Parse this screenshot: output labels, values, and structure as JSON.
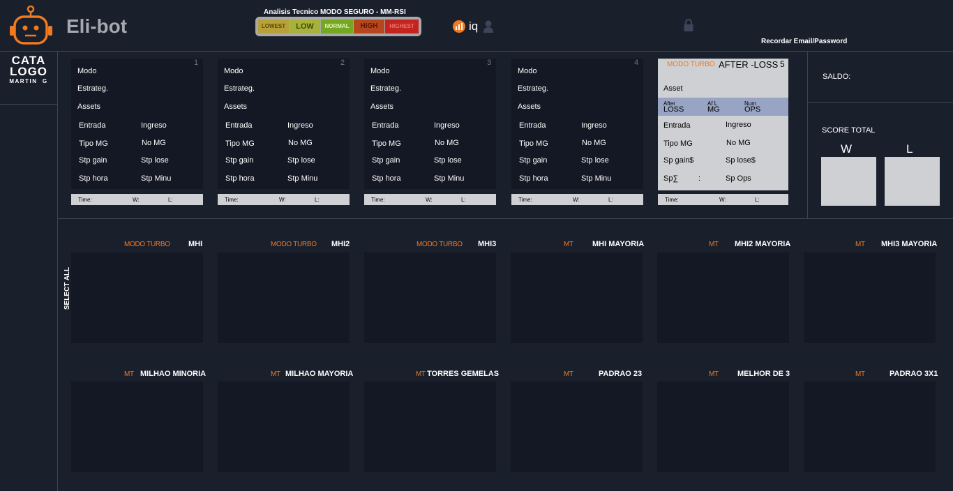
{
  "header": {
    "app_title": "Eli-bot",
    "analysis_title": "Analisis Tecnico MODO SEGURO - MM-RSI",
    "risk_levels": [
      {
        "label": "LOWEST",
        "bg": "#b8a138",
        "fg": "#5a4a08"
      },
      {
        "label": "LOW",
        "bg": "#a8b23a",
        "fg": "#3f4a0a"
      },
      {
        "label": "NORMAL",
        "bg": "#74a820",
        "fg": "#e3f0c0"
      },
      {
        "label": "HIGH",
        "bg": "#b5461d",
        "fg": "#5a1a05"
      },
      {
        "label": "HIGHEST",
        "bg": "#c4231f",
        "fg": "#e57a6a"
      }
    ],
    "broker_label": "iq",
    "remember_label": "Recordar Email/Password"
  },
  "logo": {
    "line1": "CATA",
    "line2": "LOGO",
    "line3": "MARTIN  G"
  },
  "config_panels": [
    {
      "number": "1",
      "modo": "Modo",
      "estrateg": "Estrateg.",
      "assets": "Assets",
      "entrada": "Entrada",
      "ingreso": "Ingreso",
      "tipo_mg": "Tipo MG",
      "no_mg": "No MG",
      "stp_gain": "Stp gain",
      "stp_lose": "Stp lose",
      "stp_hora": "Stp hora",
      "stp_minu": "Stp Minu",
      "time": "Time:",
      "w": "W:",
      "l": "L:"
    },
    {
      "number": "2",
      "modo": "Modo",
      "estrateg": "Estrateg.",
      "assets": "Assets",
      "entrada": "Entrada",
      "ingreso": "Ingreso",
      "tipo_mg": "Tipo MG",
      "no_mg": "No MG",
      "stp_gain": "Stp gain",
      "stp_lose": "Stp lose",
      "stp_hora": "Stp hora",
      "stp_minu": "Stp Minu",
      "time": "Time:",
      "w": "W:",
      "l": "L:"
    },
    {
      "number": "3",
      "modo": "Modo",
      "estrateg": "Estrateg.",
      "assets": "Assets",
      "entrada": "Entrada",
      "ingreso": "Ingreso",
      "tipo_mg": "Tipo MG",
      "no_mg": "No MG",
      "stp_gain": "Stp gain",
      "stp_lose": "Stp lose",
      "stp_hora": "Stp hora",
      "stp_minu": "Stp Minu",
      "time": "Time:",
      "w": "W:",
      "l": "L:"
    },
    {
      "number": "4",
      "modo": "Modo",
      "estrateg": "Estrateg.",
      "assets": "Assets",
      "entrada": "Entrada",
      "ingreso": "Ingreso",
      "tipo_mg": "Tipo MG",
      "no_mg": "No MG",
      "stp_gain": "Stp gain",
      "stp_lose": "Stp lose",
      "stp_hora": "Stp hora",
      "stp_minu": "Stp Minu",
      "time": "Time:",
      "w": "W:",
      "l": "L:"
    }
  ],
  "afterloss_panel": {
    "number": "5",
    "tag": "MODO TURBO",
    "title": "AFTER -LOSS",
    "asset": "Asset",
    "col1_small": "After",
    "col1_big": "LOSS",
    "col2_small": "Af L",
    "col2_big": "MG",
    "col3_small": "Num",
    "col3_big": "OPS",
    "entrada": "Entrada",
    "ingreso": "Ingreso",
    "tipo_mg": "Tipo MG",
    "no_mg": "No MG",
    "sp_gain": "Sp gain$",
    "sp_lose": "Sp lose$",
    "sp_sigma": "Sp∑",
    "sp_colon": ":",
    "sp_ops": "Sp Ops",
    "time": "Time:",
    "w": "W:",
    "l": "L:"
  },
  "score": {
    "saldo_label": "SALDO:",
    "total_label": "SCORE TOTAL",
    "w_label": "W",
    "l_label": "L"
  },
  "select_all_label": "SELECT ALL",
  "strategies_row1": [
    {
      "tag": "MODO TURBO",
      "name": "MHI"
    },
    {
      "tag": "MODO TURBO",
      "name": "MHI2"
    },
    {
      "tag": "MODO TURBO",
      "name": "MHI3"
    },
    {
      "tag": "MT",
      "name": "MHI MAYORIA"
    },
    {
      "tag": "MT",
      "name": "MHI2 MAYORIA"
    },
    {
      "tag": "MT",
      "name": "MHI3 MAYORIA"
    }
  ],
  "strategies_row2": [
    {
      "tag": "MT",
      "name": "MILHAO MINORIA"
    },
    {
      "tag": "MT",
      "name": "MILHAO MAYORIA"
    },
    {
      "tag": "MT",
      "name": "TORRES GEMELAS"
    },
    {
      "tag": "MT",
      "name": "PADRAO  23"
    },
    {
      "tag": "MT",
      "name": "MELHOR DE 3"
    },
    {
      "tag": "MT",
      "name": "PADRAO 3X1"
    }
  ],
  "colors": {
    "background": "#1a1f2c",
    "panel": "#141824",
    "accent": "#f07a1f",
    "light_panel": "#cfd0d4",
    "highlight_row": "#98a4c4"
  }
}
